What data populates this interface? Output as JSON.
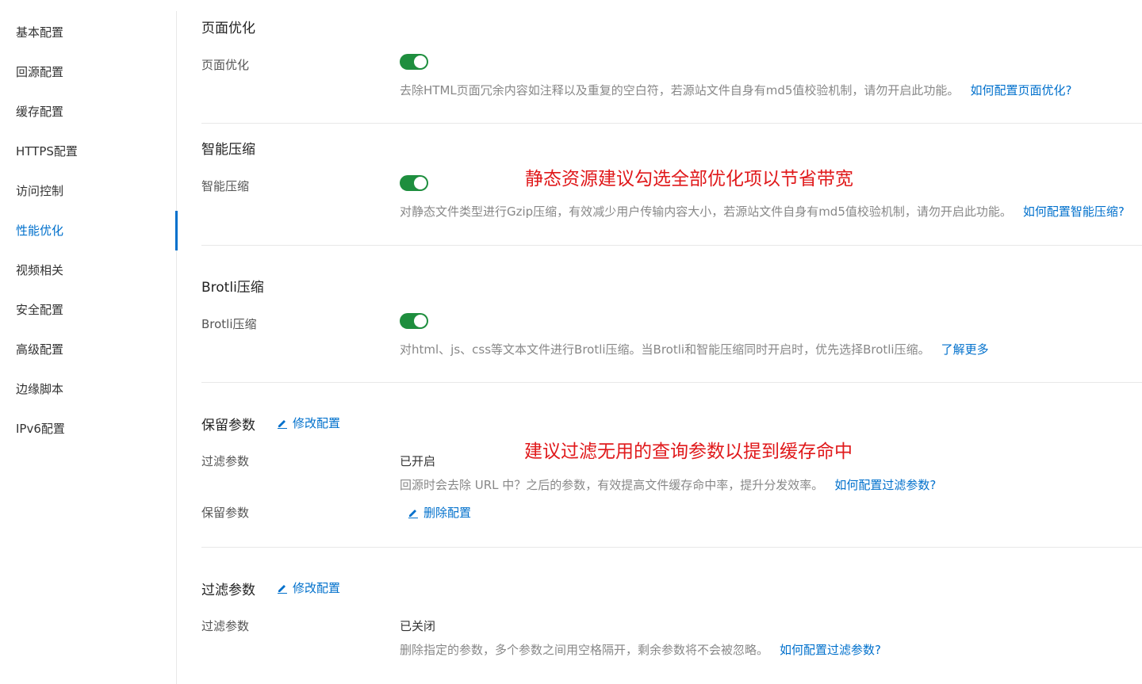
{
  "sidebar": {
    "items": [
      {
        "label": "基本配置"
      },
      {
        "label": "回源配置"
      },
      {
        "label": "缓存配置"
      },
      {
        "label": "HTTPS配置"
      },
      {
        "label": "访问控制"
      },
      {
        "label": "性能优化"
      },
      {
        "label": "视频相关"
      },
      {
        "label": "安全配置"
      },
      {
        "label": "高级配置"
      },
      {
        "label": "边缘脚本"
      },
      {
        "label": "IPv6配置"
      }
    ],
    "active_index": 5
  },
  "sections": {
    "page_opt": {
      "title": "页面优化",
      "label": "页面优化",
      "enabled": true,
      "desc": "去除HTML页面冗余内容如注释以及重复的空白符，若源站文件自身有md5值校验机制，请勿开启此功能。",
      "link": "如何配置页面优化?"
    },
    "smart_compress": {
      "title": "智能压缩",
      "label": "智能压缩",
      "enabled": true,
      "desc": "对静态文件类型进行Gzip压缩，有效减少用户传输内容大小，若源站文件自身有md5值校验机制，请勿开启此功能。",
      "link": "如何配置智能压缩?"
    },
    "brotli": {
      "title": "Brotli压缩",
      "label": "Brotli压缩",
      "enabled": true,
      "desc": "对html、js、css等文本文件进行Brotli压缩。当Brotli和智能压缩同时开启时，优先选择Brotli压缩。",
      "link": "了解更多"
    },
    "keep_params": {
      "title": "保留参数",
      "edit_label": "修改配置",
      "filter_label": "过滤参数",
      "filter_value": "已开启",
      "desc": "回源时会去除 URL 中？之后的参数，有效提高文件缓存命中率，提升分发效率。",
      "link": "如何配置过滤参数?",
      "keep_label": "保留参数",
      "delete_label": "删除配置"
    },
    "filter_params": {
      "title": "过滤参数",
      "edit_label": "修改配置",
      "filter_label": "过滤参数",
      "filter_value": "已关闭",
      "desc": "删除指定的参数，多个参数之间用空格隔开，剩余参数将不会被忽略。",
      "link": "如何配置过滤参数?"
    }
  },
  "annotations": {
    "compress_note": "静态资源建议勾选全部优化项以节省带宽",
    "params_note": "建议过滤无用的查询参数以提到缓存命中"
  },
  "colors": {
    "accent": "#0070cc",
    "toggle_on": "#1e8e3e",
    "annotation": "#e0191b"
  }
}
